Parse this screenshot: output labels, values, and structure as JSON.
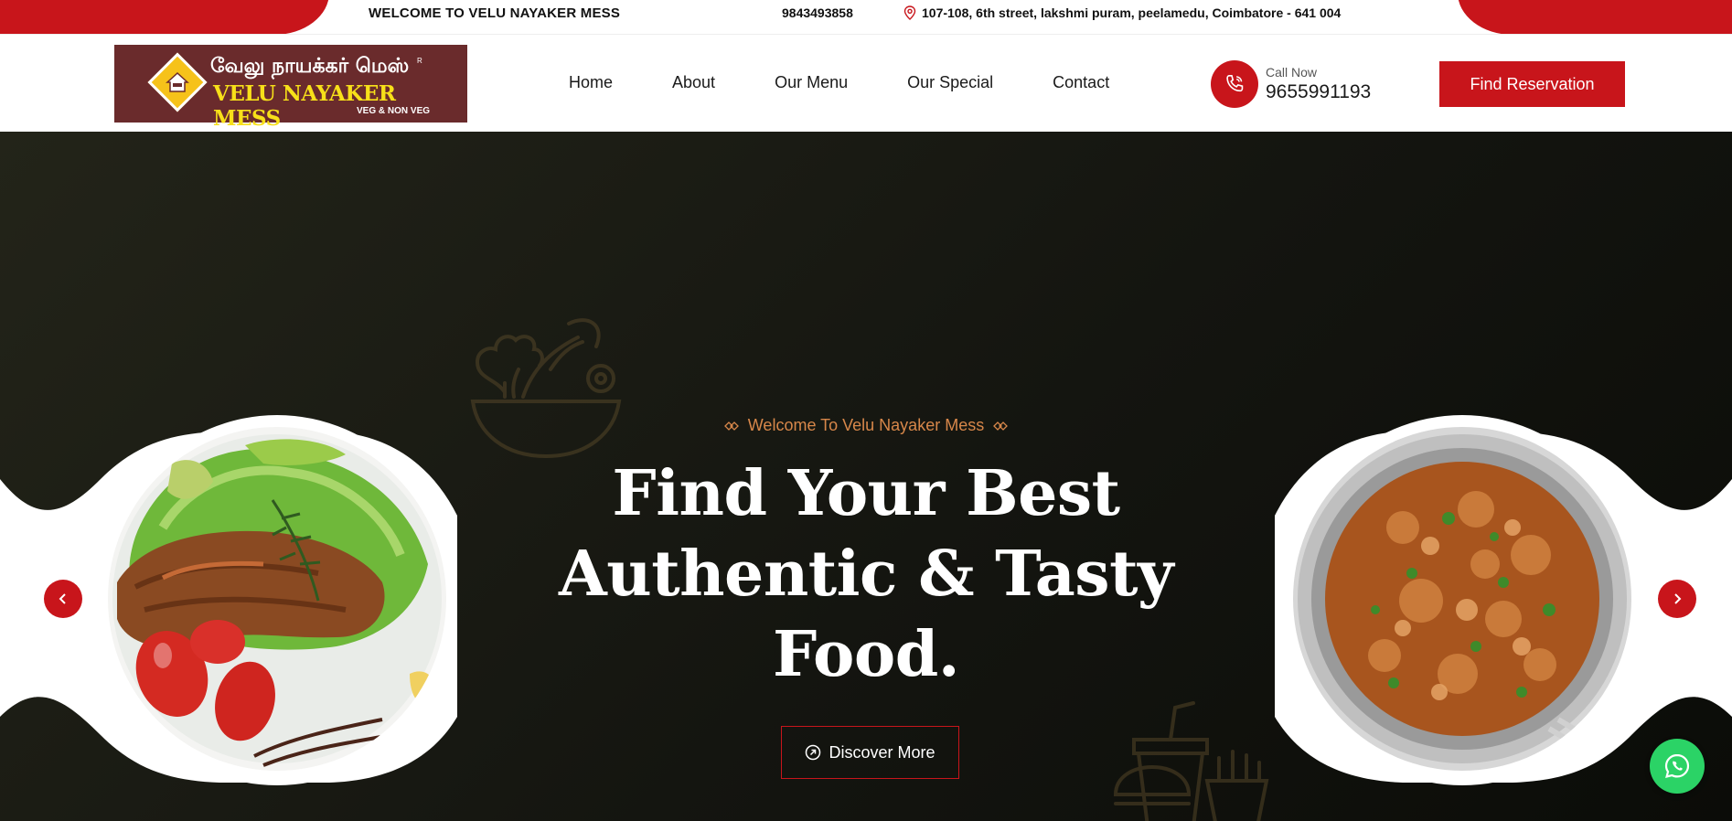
{
  "topbar": {
    "welcome": "WELCOME TO VELU NAYAKER MESS",
    "phone": "9843493858",
    "address": "107-108, 6th street, lakshmi puram, peelamedu, Coimbatore - 641 004"
  },
  "logo": {
    "tamil": "வேலு நாயக்கர் மெஸ்",
    "english": "VELU NAYAKER MESS",
    "sub": "VEG & NON VEG",
    "reg": "R"
  },
  "nav": {
    "items": [
      "Home",
      "About",
      "Our Menu",
      "Our Special",
      "Contact"
    ]
  },
  "call": {
    "label": "Call Now",
    "number": "9655991193"
  },
  "reserve_label": "Find Reservation",
  "hero": {
    "kicker": "Welcome To Velu Nayaker Mess",
    "headline_line1": "Find Your Best",
    "headline_line2": "Authentic & Tasty",
    "headline_line3": "Food.",
    "cta": "Discover More"
  },
  "colors": {
    "brand_red": "#c8151b",
    "accent_orange": "#d7874a",
    "whatsapp_green": "#2bd366",
    "hero_dark": "#141510"
  },
  "icons": {
    "location": "map-pin-icon",
    "phone": "phone-icon",
    "prev": "chevron-left-icon",
    "next": "chevron-right-icon",
    "cta": "arrow-up-right-circle-icon",
    "chat": "whatsapp-icon"
  }
}
